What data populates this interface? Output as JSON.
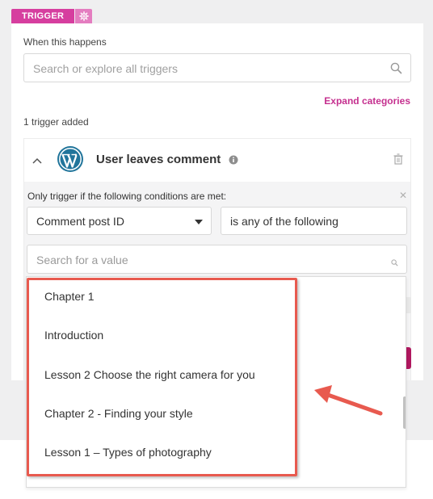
{
  "header": {
    "tab_label": "TRIGGER",
    "gear_icon": "gear-icon"
  },
  "panel": {
    "when_label": "When this happens",
    "search_placeholder": "Search or explore all triggers",
    "expand_label": "Expand categories",
    "added_label": "1 trigger added"
  },
  "trigger": {
    "title": "User leaves comment",
    "condition_label": "Only trigger if the following conditions are met:",
    "field_value": "Comment post ID",
    "operator_value": "is any of the following",
    "value_placeholder": "Search for a value"
  },
  "dropdown": {
    "options": [
      "Chapter 1",
      "Introduction",
      "Lesson 2 Choose the right camera for you",
      "Chapter 2 - Finding your style",
      "Lesson 1 – Types of photography"
    ]
  },
  "colors": {
    "accent": "#d63e9f",
    "link": "#c5308f",
    "annotation": "#e85a4f"
  }
}
